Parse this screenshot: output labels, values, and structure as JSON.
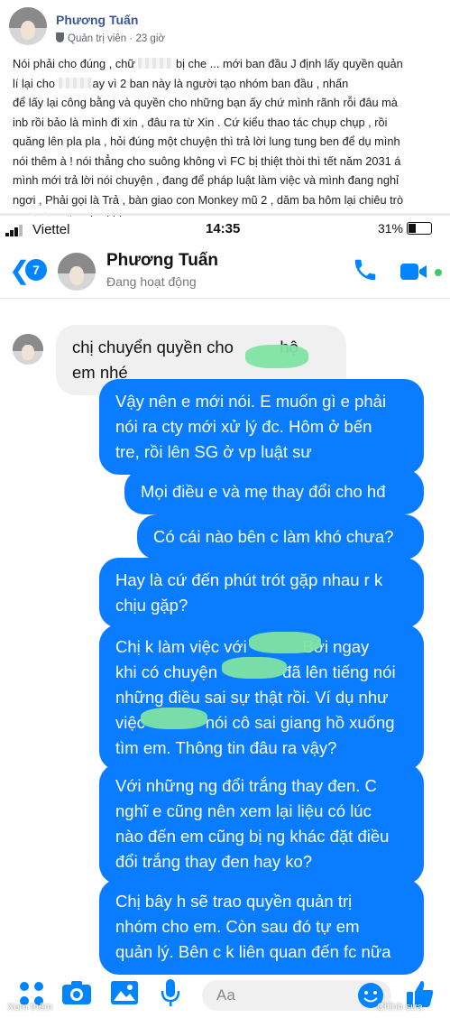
{
  "post": {
    "author": "Phương Tuấn",
    "role": "Quản trị viên",
    "time": "23 giờ",
    "text_lines": [
      [
        "Nói phải cho đúng , chữ ",
        "@blur",
        " bị che ... mới ban đầu J định lấy quyền quản"
      ],
      [
        "lí lại cho ",
        "@blur",
        "ay vì 2 ban này là người tạo nhóm ban đầu , nhấn"
      ],
      [
        "để lấy lại công bằng và quyền cho những bạn ấy chứ mình rãnh rỗi đâu mà"
      ],
      [
        "inb rồi bảo là mình đi xin , đâu ra từ Xin . Cứ kiểu thao tác chụp chụp , rồi"
      ],
      [
        "quăng lên pla pla , hỏi đúng một chuyện thì trả lời lung tung ben để dụ mình"
      ],
      [
        "nói thêm à ! nói thẳng cho suông không vì FC bị thiệt thòi thì tết năm 2031 á"
      ],
      [
        "mình mới trả lời nói chuyện , đang để pháp luật làm việc và mình đang nghỉ"
      ],
      [
        "ngơi , Phải gọi là Trả , bàn giao con Monkey mũ 2 , dăm ba hôm lại chiêu trò"
      ],
      [
        ", ngủ xíu nữa nha ! bb"
      ]
    ]
  },
  "status_bar": {
    "carrier": "Viettel",
    "time": "14:35",
    "battery": "31%"
  },
  "chat": {
    "badge_count": "7",
    "contact_name": "Phương Tuấn",
    "contact_status": "Đang hoạt động",
    "messages": [
      {
        "dir": "in",
        "lines": [
          "chị chuyển quyền cho          hộ",
          "em nhé"
        ]
      },
      {
        "dir": "out",
        "lines": [
          "Vậy nên e mới nói. E muốn gì e phải",
          "nói ra cty mới xử lý đc. Hôm ở bến",
          "tre, rồi lên SG ở vp luật sư"
        ]
      },
      {
        "dir": "out",
        "lines": [
          "Mọi điều e và mẹ thay đổi cho hđ"
        ]
      },
      {
        "dir": "out",
        "lines": [
          "Có cái nào bên c làm khó chưa?"
        ]
      },
      {
        "dir": "out",
        "lines": [
          "Hay là cứ đến phút trót gặp nhau r k",
          "chịu gặp?"
        ]
      },
      {
        "dir": "out",
        "lines": [
          "Chị k làm việc với            Bởi ngay",
          "khi có chuyện              đã lên tiếng nói",
          "những điều sai sự thật rồi. Ví dụ như",
          "việc             nói cô sai giang hồ xuống",
          "tìm em. Thông tin đâu ra vậy?"
        ]
      },
      {
        "dir": "out",
        "lines": [
          "Với những ng đổi trắng thay đen. C",
          "nghĩ e cũng nên xem lại liệu có lúc",
          "nào đến em cũng bị ng khác đặt điều",
          "đổi trắng thay đen hay ko?"
        ]
      },
      {
        "dir": "out",
        "lines": [
          "Chị bây h sẽ trao quyền quản trị",
          "nhóm cho em. Còn sau đó tự em",
          "quản lý. Bên c k liên quan đến fc nữa"
        ]
      }
    ]
  },
  "composer": {
    "placeholder": "Aa",
    "watermark_left": "Xem thêm",
    "watermark_right": "Chỉnh sửa"
  },
  "colors": {
    "messenger_blue": "#0a7cff",
    "link_blue": "#0084ff",
    "fb_name": "#3b5998",
    "incoming_bg": "#f1f0f0",
    "active_green": "#44c767",
    "redaction_green": "#7ee3a3"
  },
  "icons": [
    "back-chevron-icon",
    "phone-icon",
    "video-camera-icon",
    "apps-icon",
    "camera-icon",
    "image-icon",
    "microphone-icon",
    "emoji-icon",
    "thumbs-up-icon",
    "shield-icon"
  ]
}
